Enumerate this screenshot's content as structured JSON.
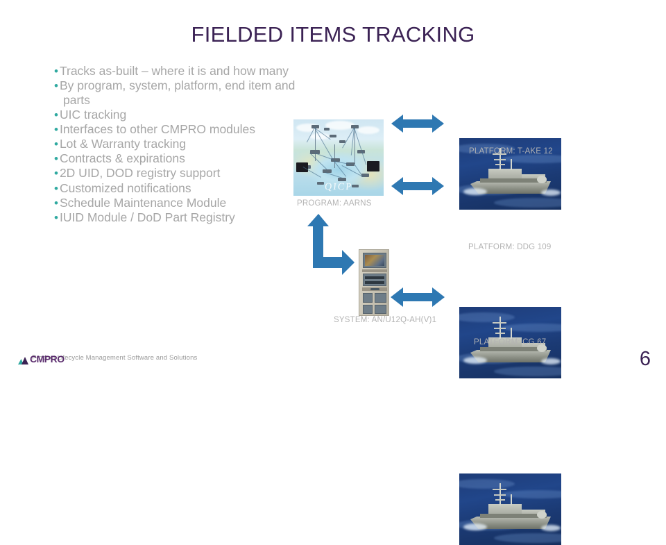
{
  "slide": {
    "title": "FIELDED ITEMS TRACKING",
    "page_number": "6",
    "background_color": "#ffffff",
    "title_color": "#3B2254",
    "bullet_text_color": "#A6A6A6",
    "bullet_marker_color": "#2FA9A0",
    "caption_color": "#B3B3B3",
    "arrow_color": "#2E78B2"
  },
  "bullets": [
    "Tracks as-built – where it is and how many",
    "By program, system, platform, end item and parts",
    "UIC tracking",
    "Interfaces to other CMPRO modules",
    "Lot & Warranty tracking",
    "Contracts & expirations",
    "2D UID, DOD registry support",
    "Customized notifications",
    "Schedule Maintenance Module",
    "IUID Module / DoD Part Registry"
  ],
  "bullet_marker": "•",
  "figures": {
    "program": {
      "caption": "PROGRAM: AARNS",
      "image_name": "network-centric-battlespace-diagram",
      "watermark": "QICP"
    },
    "system": {
      "caption": "SYSTEM: AN/U12Q-AH(V)1",
      "image_name": "equipment-rack-photo"
    },
    "platforms": [
      {
        "caption": "PLATFORM: T-AKE 12",
        "image_name": "navy-ship-photo"
      },
      {
        "caption": "PLATFORM: DDG 109",
        "image_name": "navy-ship-photo"
      },
      {
        "caption": "PLATFORM: CG 67",
        "image_name": "navy-ship-photo"
      }
    ]
  },
  "arrows": [
    {
      "name": "arrow-program-to-take12",
      "type": "double-horizontal"
    },
    {
      "name": "arrow-program-to-ddg109",
      "type": "double-horizontal"
    },
    {
      "name": "arrow-program-to-system",
      "type": "elbow-up-right"
    },
    {
      "name": "arrow-system-to-cg67",
      "type": "double-horizontal"
    }
  ],
  "footer": {
    "logo_text": "CMPRO",
    "logo_mark_name": "cmpro-mountain-logo",
    "tagline": "Product Lifecycle Management Software and Solutions"
  }
}
